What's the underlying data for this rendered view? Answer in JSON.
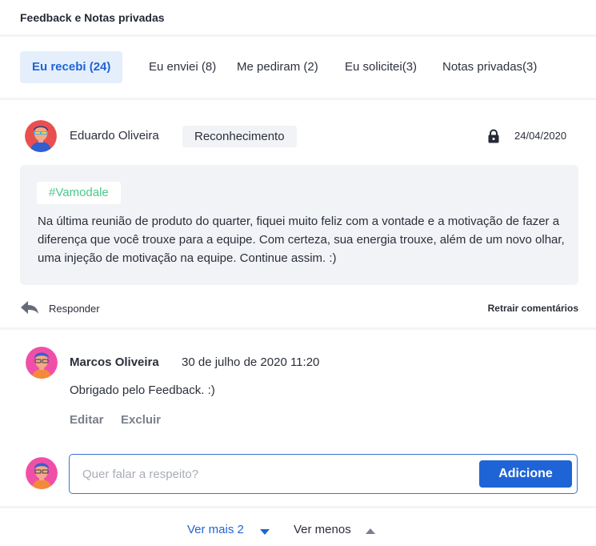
{
  "header": {
    "title": "Feedback e Notas privadas"
  },
  "tabs": [
    {
      "label": "Eu recebi (24)",
      "active": true
    },
    {
      "label": "Eu enviei (8)",
      "active": false
    },
    {
      "label": "Me pediram (2)",
      "active": false
    },
    {
      "label": "Eu solicitei(3)",
      "active": false
    },
    {
      "label": "Notas privadas(3)",
      "active": false
    }
  ],
  "feedback": {
    "author": "Eduardo Oliveira",
    "tag": "Reconhecimento",
    "date": "24/04/2020",
    "lock_icon": "lock-icon",
    "hashtag": "#Vamodale",
    "message": "Na última reunião de produto do quarter, fiquei muito feliz com a vontade e a motivação de fazer a diferença que você trouxe para a equipe. Com certeza, sua energia trouxe, além de um novo olhar, uma injeção de motivação na equipe. Continue assim. :)"
  },
  "actions": {
    "reply_icon": "reply-icon",
    "reply_label": "Responder",
    "collapse_label": "Retrair comentários"
  },
  "comment": {
    "author": "Marcos Oliveira",
    "time": "30 de julho de 2020 11:20",
    "text": "Obrigado pelo Feedback. :)",
    "edit_label": "Editar",
    "delete_label": "Excluir"
  },
  "compose": {
    "placeholder": "Quer falar a respeito?",
    "value": "",
    "submit_label": "Adicione"
  },
  "footer": {
    "more_label": "Ver mais 2",
    "less_label": "Ver menos"
  },
  "colors": {
    "accent": "#1f64d6",
    "hashtag": "#4bc98a",
    "panel": "#f1f3f6"
  }
}
